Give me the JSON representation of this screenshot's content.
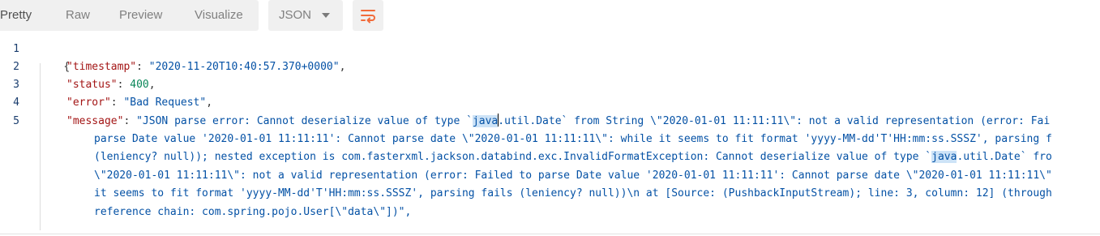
{
  "toolbar": {
    "tabs": [
      "Pretty",
      "Raw",
      "Preview",
      "Visualize"
    ],
    "format_selected": "JSON",
    "wrap_icon": "wrap-lines-icon"
  },
  "editor": {
    "line_numbers": [
      "1",
      "2",
      "3",
      "4",
      "5"
    ],
    "open_brace": "{",
    "timestamp_key": "\"timestamp\"",
    "timestamp_value": "\"2020-11-20T10:40:57.370+0000\"",
    "status_key": "\"status\"",
    "status_value": "400",
    "error_key": "\"error\"",
    "error_value": "\"Bad Request\"",
    "message_key": "\"message\"",
    "message_line1_a": "\"JSON parse error: Cannot deserialize value of type `",
    "message_line1_hl": "java",
    "message_line1_b": ".util.Date` from String \\\"2020-01-01 11:11:11\\\": not a valid representation (error: Fai",
    "message_wrap2": "parse Date value '2020-01-01 11:11:11': Cannot parse date \\\"2020-01-01 11:11:11\\\": while it seems to fit format 'yyyy-MM-dd'T'HH:mm:ss.SSSZ', parsing f",
    "message_wrap3_a": "(leniency? null)); nested exception is com.fasterxml.jackson.databind.exc.InvalidFormatException: Cannot deserialize value of type `",
    "message_wrap3_hl": "java",
    "message_wrap3_b": ".util.Date` fro",
    "message_wrap4": "\\\"2020-01-01 11:11:11\\\": not a valid representation (error: Failed to parse Date value '2020-01-01 11:11:11': Cannot parse date \\\"2020-01-01 11:11:11\\\"",
    "message_wrap5": "it seems to fit format 'yyyy-MM-dd'T'HH:mm:ss.SSSZ', parsing fails (leniency? null))\\n at [Source: (PushbackInputStream); line: 3, column: 12] (through",
    "message_wrap6": "reference chain: com.spring.pojo.User[\\\"data\\\"])\","
  }
}
